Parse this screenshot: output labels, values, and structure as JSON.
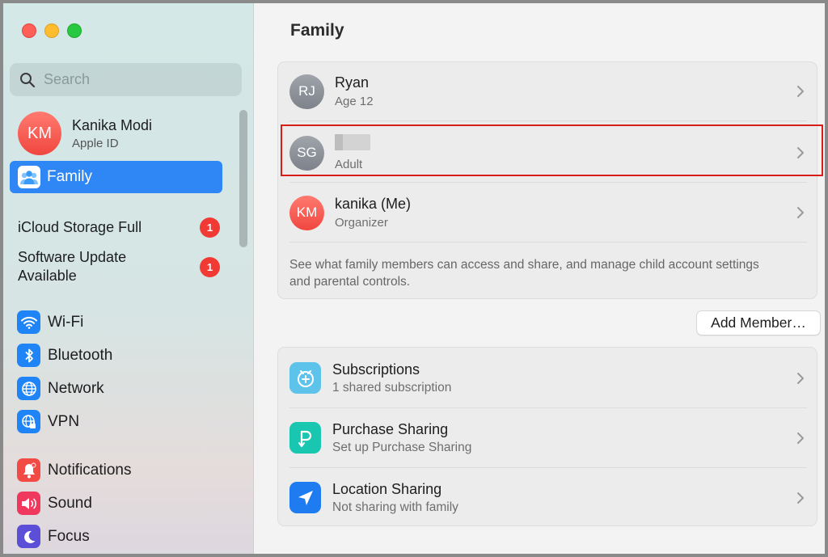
{
  "window": {
    "title": "Family"
  },
  "sidebar": {
    "search_placeholder": "Search",
    "account": {
      "initials": "KM",
      "name": "Kanika Modi",
      "subtitle": "Apple ID"
    },
    "selected": {
      "label": "Family",
      "icon": "family-icon"
    },
    "alerts": [
      {
        "label": "iCloud Storage Full",
        "badge": "1"
      },
      {
        "label": "Software Update\nAvailable",
        "badge": "1"
      }
    ],
    "items": [
      {
        "label": "Wi-Fi",
        "icon": "wifi-icon"
      },
      {
        "label": "Bluetooth",
        "icon": "bluetooth-icon"
      },
      {
        "label": "Network",
        "icon": "globe-icon"
      },
      {
        "label": "VPN",
        "icon": "vpn-icon"
      },
      {
        "label": "Notifications",
        "icon": "bell-icon"
      },
      {
        "label": "Sound",
        "icon": "speaker-icon"
      },
      {
        "label": "Focus",
        "icon": "moon-icon"
      }
    ]
  },
  "members": [
    {
      "initials": "RJ",
      "name": "Ryan",
      "detail": "Age 12"
    },
    {
      "initials": "SG",
      "name": "",
      "detail": "Adult"
    },
    {
      "initials": "KM",
      "name": "kanika (Me)",
      "detail": "Organizer"
    }
  ],
  "family_description": "See what family members can access and share, and manage child account settings and parental controls.",
  "add_member_label": "Add Member…",
  "features": [
    {
      "title": "Subscriptions",
      "subtitle": "1 shared subscription",
      "icon": "subscriptions-icon"
    },
    {
      "title": "Purchase Sharing",
      "subtitle": "Set up Purchase Sharing",
      "icon": "purchase-sharing-icon"
    },
    {
      "title": "Location Sharing",
      "subtitle": "Not sharing with family",
      "icon": "location-arrow-icon"
    }
  ],
  "colors": {
    "accent": "#2f87f5",
    "badge": "#f23a35",
    "highlight": "#d91e18"
  }
}
